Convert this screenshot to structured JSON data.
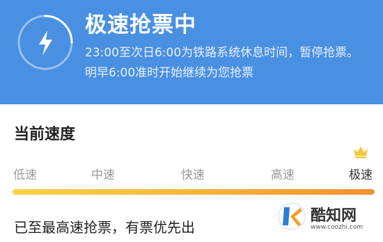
{
  "header": {
    "title": "极速抢票中",
    "description": "23:00至次日6:00为铁路系统休息时间，暂停抢票。明早6:00准时开始继续为您抢票",
    "icon": "lightning-icon",
    "color": "#4a90e2"
  },
  "speed": {
    "title": "当前速度",
    "levels": [
      "低速",
      "中速",
      "快速",
      "高速",
      "极速"
    ],
    "current_level": "极速",
    "progress": 1.0,
    "status": "已至最高速抢票，有票优先出"
  },
  "watermark": {
    "name": "酷知网",
    "url": "www.coozhi.com"
  }
}
